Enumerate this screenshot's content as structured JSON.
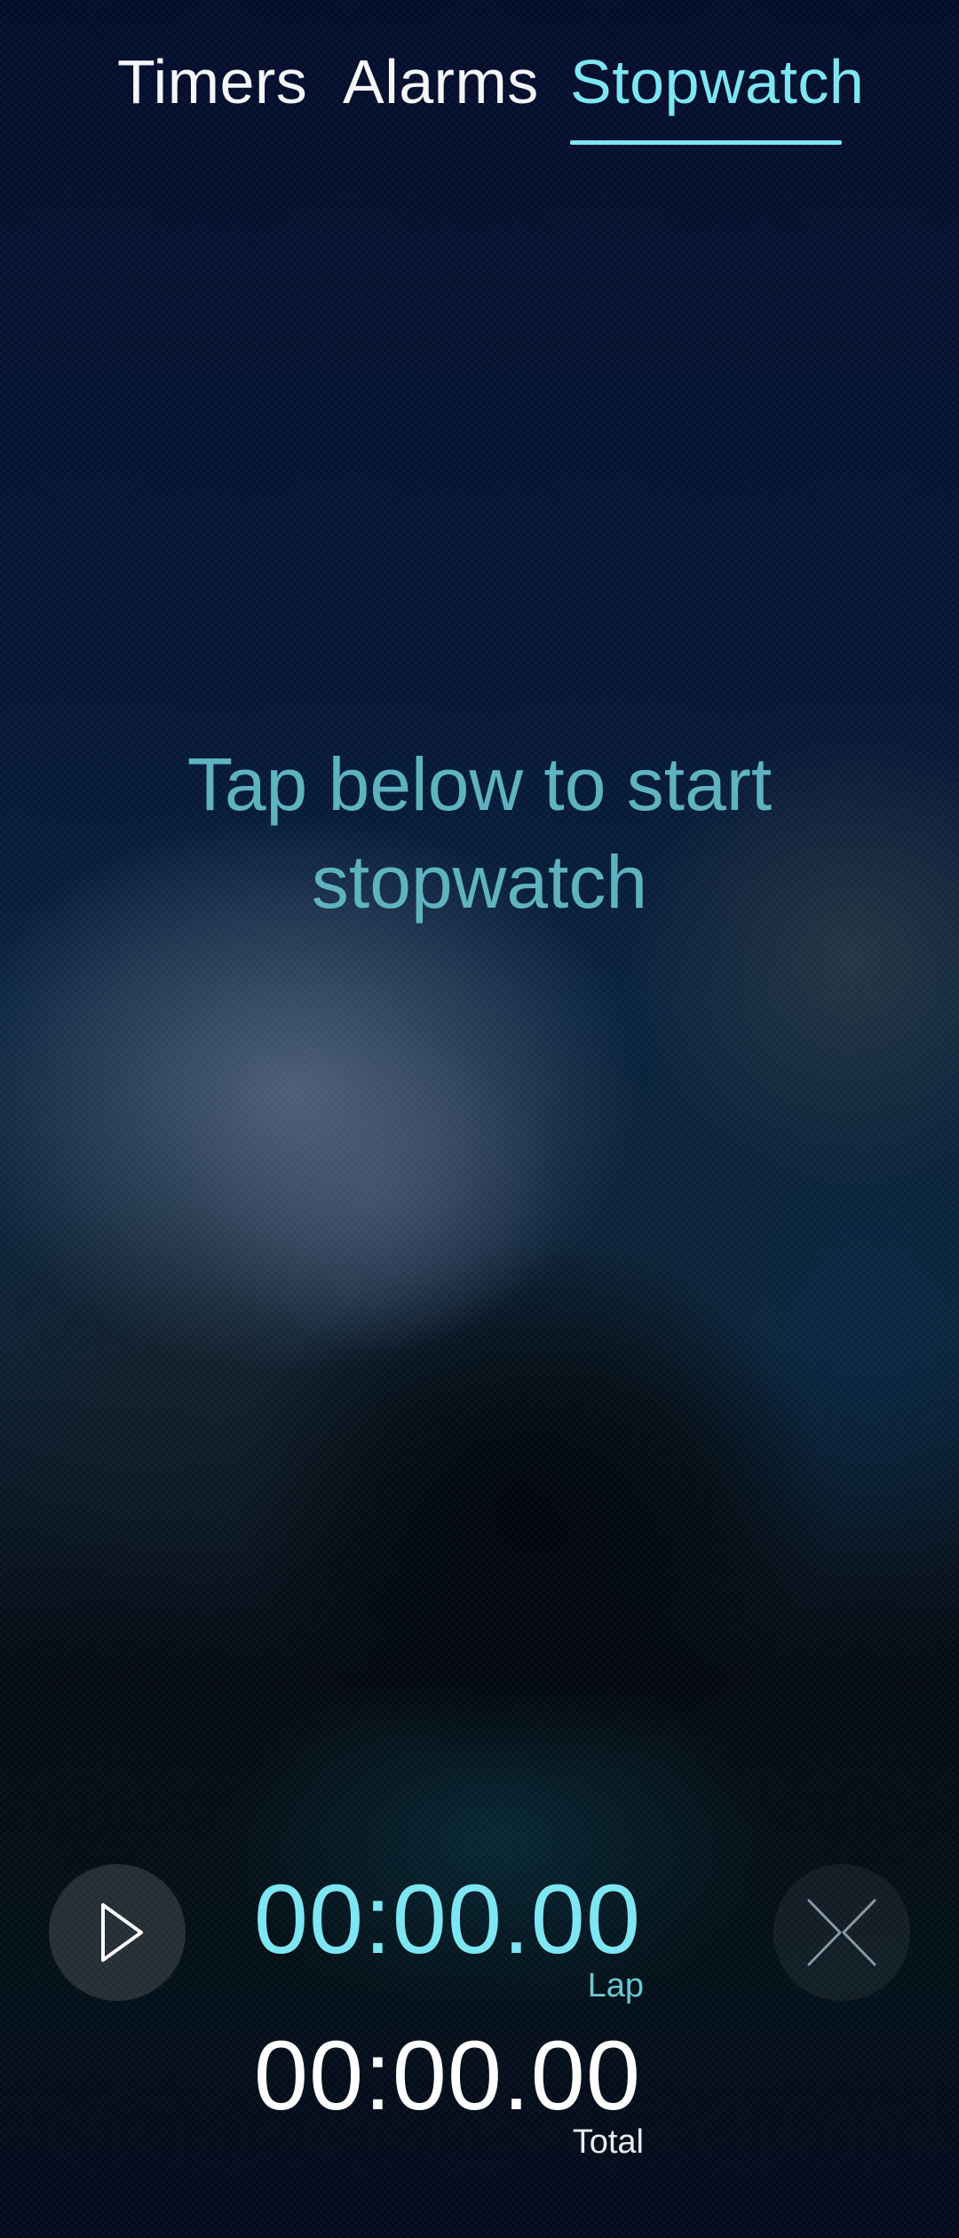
{
  "tabs": [
    {
      "label": "Timers",
      "active": false
    },
    {
      "label": "Alarms",
      "active": false
    },
    {
      "label": "Stopwatch",
      "active": true
    }
  ],
  "hint": {
    "line1": "Tap below to start",
    "line2": "stopwatch"
  },
  "stopwatch": {
    "lap_time": "00:00.00",
    "lap_label": "Lap",
    "total_time": "00:00.00",
    "total_label": "Total"
  },
  "controls": {
    "start_icon": "play-icon",
    "lap_icon": "lap-icon"
  },
  "colors": {
    "accent": "#7de6f2",
    "hint": "#5fb3c0",
    "background": "#02102a"
  }
}
